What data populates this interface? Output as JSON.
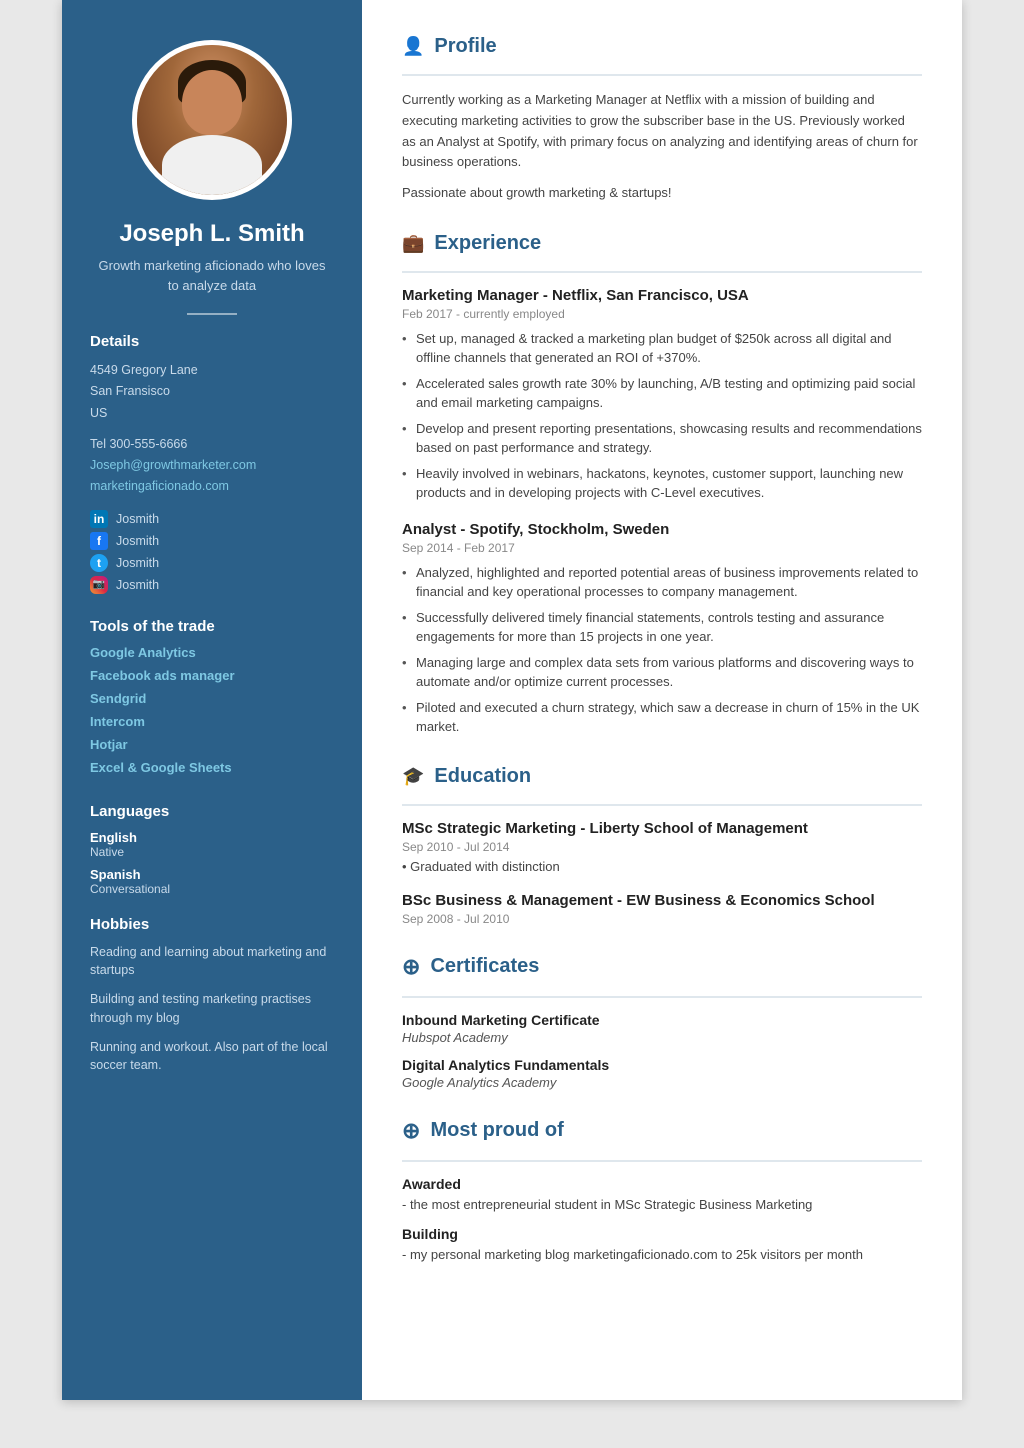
{
  "sidebar": {
    "name": "Joseph L. Smith",
    "tagline": "Growth marketing aficionado who loves to analyze data",
    "details": {
      "address_line1": "4549 Gregory Lane",
      "address_line2": "San Fransisco",
      "address_line3": "US",
      "phone": "Tel 300-555-6666",
      "email": "Joseph@growthmarketer.com",
      "website": "marketingaficionado.com"
    },
    "socials": [
      {
        "platform": "linkedin",
        "handle": "Josmith",
        "label": "in"
      },
      {
        "platform": "facebook",
        "handle": "Josmith",
        "label": "f"
      },
      {
        "platform": "twitter",
        "handle": "Josmith",
        "label": "t"
      },
      {
        "platform": "instagram",
        "handle": "Josmith",
        "label": "ig"
      }
    ],
    "tools_title": "Tools of the trade",
    "tools": [
      "Google Analytics",
      "Facebook ads manager",
      "Sendgrid",
      "Intercom",
      "Hotjar",
      "Excel & Google Sheets"
    ],
    "languages_title": "Languages",
    "languages": [
      {
        "name": "English",
        "level": "Native"
      },
      {
        "name": "Spanish",
        "level": "Conversational"
      }
    ],
    "hobbies_title": "Hobbies",
    "hobbies": [
      "Reading and learning about marketing and startups",
      "Building and testing marketing practises through my blog",
      "Running and workout. Also part of the local soccer team."
    ]
  },
  "main": {
    "profile": {
      "section_title": "Profile",
      "icon": "👤",
      "paragraphs": [
        "Currently working as a Marketing Manager at Netflix with a mission of building and executing marketing activities to grow the subscriber base in the US. Previously worked as an Analyst at Spotify, with primary focus on analyzing and identifying areas of churn for business operations.",
        "Passionate about growth marketing & startups!"
      ]
    },
    "experience": {
      "section_title": "Experience",
      "icon": "💼",
      "jobs": [
        {
          "title": "Marketing Manager - Netflix, San Francisco, USA",
          "date": "Feb 2017 - currently employed",
          "bullets": [
            "Set up, managed & tracked a marketing plan budget of $250k across all digital and offline channels that generated an ROI of +370%.",
            "Accelerated sales growth rate 30% by launching, A/B testing and optimizing paid social and email marketing campaigns.",
            "Develop and present reporting presentations, showcasing results and recommendations based on past performance and strategy.",
            "Heavily involved in webinars, hackatons, keynotes, customer support, launching new products and in developing projects with C-Level executives."
          ]
        },
        {
          "title": "Analyst - Spotify, Stockholm, Sweden",
          "date": "Sep 2014 - Feb 2017",
          "bullets": [
            "Analyzed, highlighted and reported potential areas of business improvements related to financial and key operational processes to company management.",
            "Successfully delivered timely financial statements, controls testing and assurance engagements for more than 15 projects in one year.",
            "Managing large and complex data sets from various platforms and discovering ways to automate and/or optimize current processes.",
            "Piloted and executed a churn strategy, which saw a decrease in churn of 15% in the UK market."
          ]
        }
      ]
    },
    "education": {
      "section_title": "Education",
      "icon": "🎓",
      "schools": [
        {
          "title": "MSc Strategic Marketing - Liberty School of Management",
          "date": "Sep 2010 - Jul 2014",
          "detail": "• Graduated with distinction"
        },
        {
          "title": "BSc Business & Management - EW Business & Economics School",
          "date": "Sep 2008 - Jul 2010",
          "detail": ""
        }
      ]
    },
    "certificates": {
      "section_title": "Certificates",
      "icon": "➕",
      "items": [
        {
          "name": "Inbound Marketing Certificate",
          "issuer": "Hubspot Academy"
        },
        {
          "name": "Digital Analytics Fundamentals",
          "issuer": "Google Analytics Academy"
        }
      ]
    },
    "most_proud": {
      "section_title": "Most proud of",
      "icon": "➕",
      "items": [
        {
          "title": "Awarded",
          "description": "- the most entrepreneurial student in MSc Strategic Business Marketing"
        },
        {
          "title": "Building",
          "description": "- my personal marketing blog marketingaficionado.com to 25k visitors per month"
        }
      ]
    }
  }
}
